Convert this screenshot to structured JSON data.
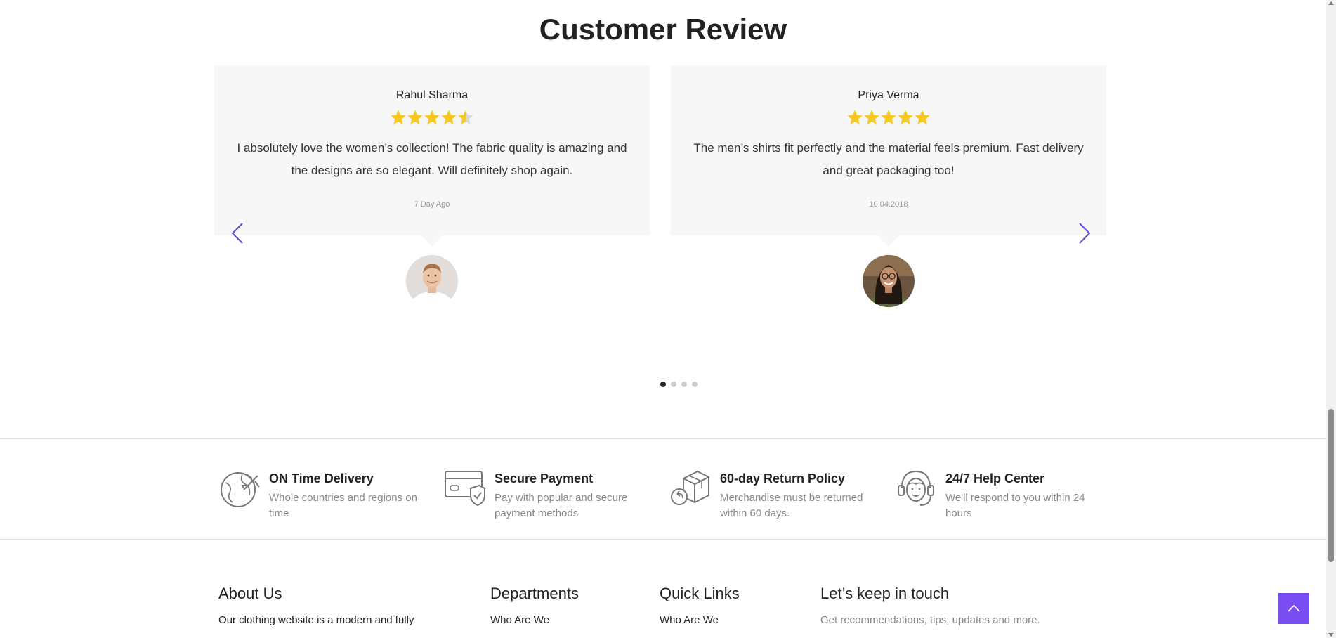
{
  "section": {
    "title": "Customer Review"
  },
  "reviews": [
    {
      "name": "Rahul Sharma",
      "rating": 4.5,
      "text": "I absolutely love the women’s collection! The fabric quality is amazing and the designs are so elegant. Will definitely shop again.",
      "date": "7 Day Ago"
    },
    {
      "name": "Priya Verma",
      "rating": 5,
      "text": "The men’s shirts fit perfectly and the material feels premium. Fast delivery and great packaging too!",
      "date": "10.04.2018"
    }
  ],
  "carousel": {
    "page_count": 4,
    "active_page": 1
  },
  "features": [
    {
      "icon": "globe-plane-icon",
      "title": "ON Time Delivery",
      "desc": "Whole countries and regions on time"
    },
    {
      "icon": "credit-card-shield-icon",
      "title": "Secure Payment",
      "desc": "Pay with popular and secure payment methods"
    },
    {
      "icon": "box-return-icon",
      "title": "60-day Return Policy",
      "desc": "Merchandise must be returned within 60 days."
    },
    {
      "icon": "headset-support-icon",
      "title": "24/7 Help Center",
      "desc": "We'll respond to you within 24 hours"
    }
  ],
  "footer": {
    "about": {
      "heading": "About Us",
      "text": "Our clothing website is a modern and fully"
    },
    "departments": {
      "heading": "Departments",
      "items": [
        "Who Are We"
      ]
    },
    "quick_links": {
      "heading": "Quick Links",
      "items": [
        "Who Are We"
      ]
    },
    "keep_in_touch": {
      "heading": "Let’s keep in touch",
      "text": "Get recommendations, tips, updates and more."
    }
  },
  "colors": {
    "star": "#f7c81f",
    "accent": "#7a4df2",
    "arrow": "#5b4ed6"
  }
}
